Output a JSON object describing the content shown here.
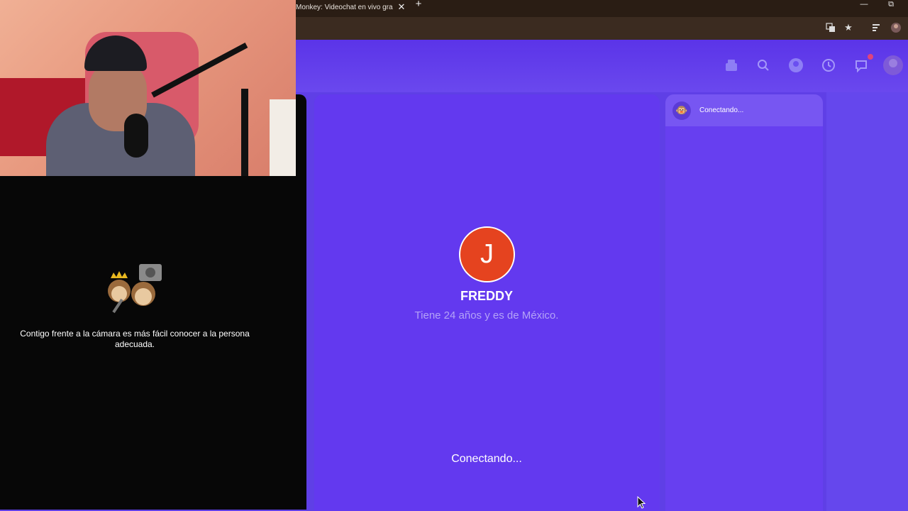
{
  "browser": {
    "tab_title": "Monkey: Videochat en vivo gra",
    "tab_close": "✕",
    "new_tab": "+",
    "window_minimize": "—",
    "window_restore": "⧉",
    "toolbar_icons": [
      "translate-icon",
      "star-icon",
      "tab-search-icon",
      "profile-icon"
    ]
  },
  "header": {
    "icons": [
      "shop-icon",
      "search-icon",
      "user-icon",
      "history-icon",
      "chat-icon",
      "avatar-icon"
    ]
  },
  "partner": {
    "initial": "J",
    "name": "FREDDY",
    "info": "Tiene 24 años y es de México.",
    "status": "Conectando..."
  },
  "chat": {
    "status": "Conectando..."
  },
  "self_video": {
    "message": "Contigo frente a la cámara es más fácil conocer a la persona adecuada."
  },
  "colors": {
    "accent": "#6339ef",
    "avatar_bg": "#e5431f",
    "badge": "#e0437d"
  }
}
